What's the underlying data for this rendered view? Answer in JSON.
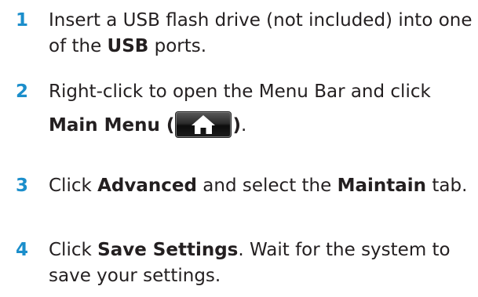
{
  "steps": [
    {
      "number": "1",
      "text_a": "Insert a USB flash drive (not included) into one of the ",
      "bold_a": "USB",
      "text_b": " ports."
    },
    {
      "number": "2",
      "text_a": "Right-click to open the Menu Bar and click",
      "bold_a": "Main Menu (",
      "icon": "home-icon",
      "bold_b": ")",
      "text_b": "."
    },
    {
      "number": "3",
      "text_a": "Click ",
      "bold_a": "Advanced",
      "text_b": " and select the ",
      "bold_b": "Maintain",
      "text_c": " tab."
    },
    {
      "number": "4",
      "text_a": "Click ",
      "bold_a": "Save Settings",
      "text_b": ". Wait for the system to save your settings."
    }
  ],
  "colors": {
    "step_number": "#1b8ecb",
    "body_text": "#231f20",
    "home_icon": "#ffffff"
  }
}
